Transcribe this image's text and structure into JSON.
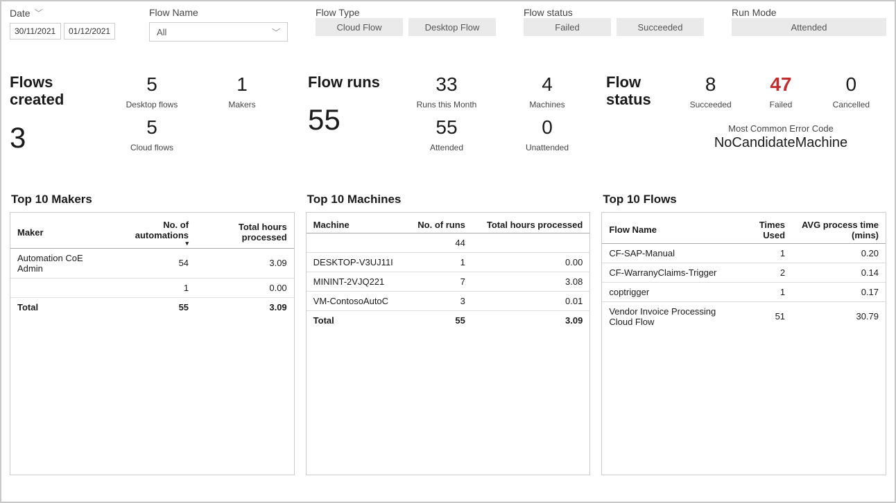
{
  "filters": {
    "date": {
      "label": "Date",
      "start": "30/11/2021",
      "end": "01/12/2021"
    },
    "flowname": {
      "label": "Flow Name",
      "value": "All"
    },
    "flowtype": {
      "label": "Flow Type",
      "opt1": "Cloud Flow",
      "opt2": "Desktop Flow"
    },
    "flowstatus": {
      "label": "Flow status",
      "opt1": "Failed",
      "opt2": "Succeeded"
    },
    "runmode": {
      "label": "Run Mode",
      "opt1": "Attended"
    }
  },
  "kpi": {
    "flows_created": {
      "label": "Flows created",
      "value": "3",
      "desktop": {
        "value": "5",
        "label": "Desktop flows"
      },
      "cloud": {
        "value": "5",
        "label": "Cloud flows"
      },
      "makers": {
        "value": "1",
        "label": "Makers"
      }
    },
    "flow_runs": {
      "label": "Flow runs",
      "value": "55",
      "month": {
        "value": "33",
        "label": "Runs this Month"
      },
      "attended": {
        "value": "55",
        "label": "Attended"
      },
      "machines": {
        "value": "4",
        "label": "Machines"
      },
      "unattended": {
        "value": "0",
        "label": "Unattended"
      }
    },
    "flow_status": {
      "label": "Flow status",
      "succeeded": {
        "value": "8",
        "label": "Succeeded"
      },
      "failed": {
        "value": "47",
        "label": "Failed"
      },
      "cancelled": {
        "value": "0",
        "label": "Cancelled"
      },
      "err_caption": "Most Common Error Code",
      "err_code": "NoCandidateMachine"
    }
  },
  "tables": {
    "makers": {
      "title": "Top 10 Makers",
      "cols": {
        "c1": "Maker",
        "c2": "No. of automations",
        "c3": "Total hours processed"
      },
      "rows": [
        {
          "c1": "Automation CoE Admin",
          "c2": "54",
          "c3": "3.09"
        },
        {
          "c1": "",
          "c2": "1",
          "c3": "0.00"
        }
      ],
      "total": {
        "c1": "Total",
        "c2": "55",
        "c3": "3.09"
      }
    },
    "machines": {
      "title": "Top 10 Machines",
      "cols": {
        "c1": "Machine",
        "c2": "No. of runs",
        "c3": "Total hours processed"
      },
      "rows": [
        {
          "c1": "",
          "c2": "44",
          "c3": ""
        },
        {
          "c1": "DESKTOP-V3UJ11I",
          "c2": "1",
          "c3": "0.00"
        },
        {
          "c1": "MININT-2VJQ221",
          "c2": "7",
          "c3": "3.08"
        },
        {
          "c1": "VM-ContosoAutoC",
          "c2": "3",
          "c3": "0.01"
        }
      ],
      "total": {
        "c1": "Total",
        "c2": "55",
        "c3": "3.09"
      }
    },
    "flows": {
      "title": "Top 10 Flows",
      "cols": {
        "c1": "Flow Name",
        "c2": "Times Used",
        "c3": "AVG process time (mins)"
      },
      "rows": [
        {
          "c1": "CF-SAP-Manual",
          "c2": "1",
          "c3": "0.20"
        },
        {
          "c1": "CF-WarranyClaims-Trigger",
          "c2": "2",
          "c3": "0.14"
        },
        {
          "c1": "coptrigger",
          "c2": "1",
          "c3": "0.17"
        },
        {
          "c1": "Vendor Invoice Processing Cloud Flow",
          "c2": "51",
          "c3": "30.79"
        }
      ]
    }
  }
}
